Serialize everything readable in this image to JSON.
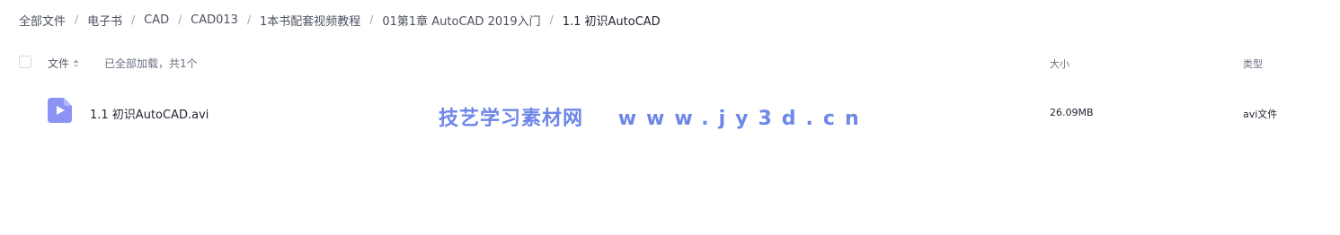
{
  "breadcrumb": {
    "items": [
      "全部文件",
      "电子书",
      "CAD",
      "CAD013",
      "1本书配套视频教程",
      "01第1章 AutoCAD 2019入门",
      "1.1 初识AutoCAD"
    ],
    "separator": "/"
  },
  "header": {
    "name_label": "文件",
    "loaded_text": "已全部加载，共1个",
    "size_label": "大小",
    "type_label": "类型"
  },
  "files": [
    {
      "name": "1.1 初识AutoCAD.avi",
      "size": "26.09MB",
      "type": "avi文件",
      "icon": "video-file-icon",
      "icon_color": "#8c93f5"
    }
  ],
  "watermark": {
    "cn": "技艺学习素材网",
    "url": "www.jy3d.cn",
    "color": "#6e86e8"
  }
}
